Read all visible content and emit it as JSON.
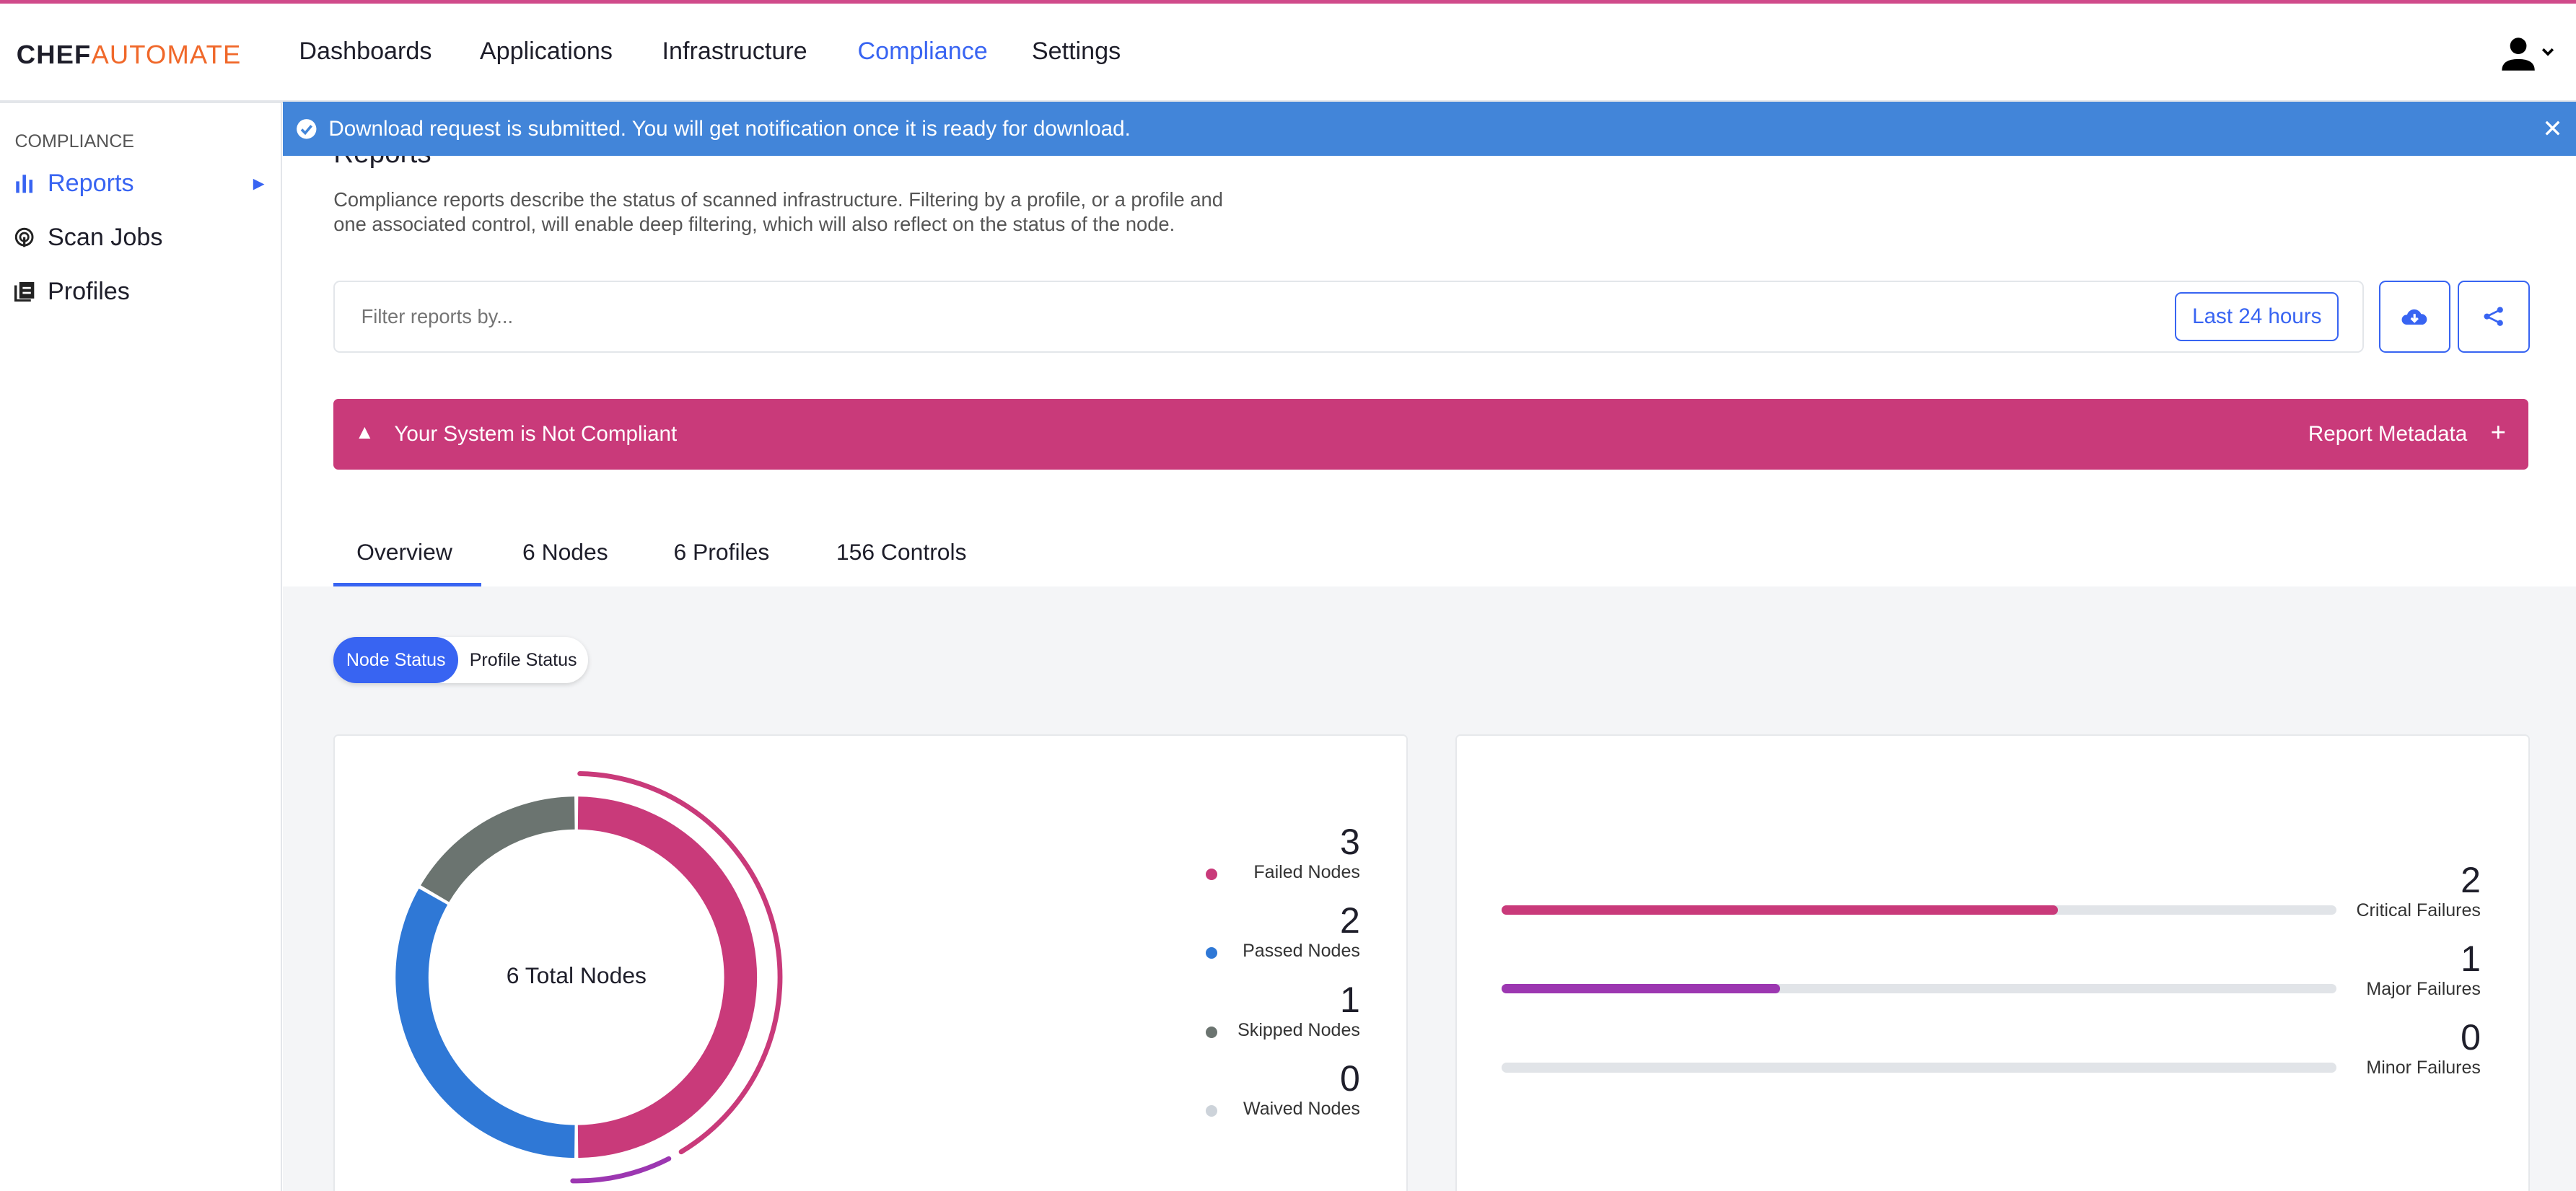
{
  "header": {
    "logo_bold": "CHEF",
    "logo_light": "AUTOMATE",
    "nav": [
      {
        "label": "Dashboards"
      },
      {
        "label": "Applications"
      },
      {
        "label": "Infrastructure"
      },
      {
        "label": "Compliance",
        "active": true
      },
      {
        "label": "Settings"
      }
    ]
  },
  "sidebar": {
    "section": "COMPLIANCE",
    "items": [
      {
        "label": "Reports",
        "icon": "bar-chart-icon",
        "active": true
      },
      {
        "label": "Scan Jobs",
        "icon": "radar-icon"
      },
      {
        "label": "Profiles",
        "icon": "book-icon"
      }
    ]
  },
  "banner": {
    "text": "Download request is submitted. You will get notification once it is ready for download.",
    "icon": "check-circle-icon"
  },
  "page": {
    "title": "Reports",
    "description": "Compliance reports describe the status of scanned infrastructure. Filtering by a profile, or a profile and one associated control, will enable deep filtering, which will also reflect on the status of the node."
  },
  "filter": {
    "placeholder": "Filter reports by...",
    "value": "",
    "date_range": "Last 24 hours"
  },
  "alert": {
    "text": "Your System is Not Compliant",
    "metadata": "Report Metadata",
    "plus": "+"
  },
  "tabs": [
    {
      "label": "Overview",
      "active": true
    },
    {
      "label": "6 Nodes"
    },
    {
      "label": "6 Profiles"
    },
    {
      "label": "156 Controls"
    }
  ],
  "toggle": {
    "options": [
      "Node Status",
      "Profile Status"
    ],
    "selected": "Node Status"
  },
  "colors": {
    "failed": "#c93a7a",
    "passed": "#2f78d6",
    "skipped": "#6b7470",
    "waived": "#cdd3da",
    "major": "#9c37b1",
    "accent": "#3864f2"
  },
  "chart_data": [
    {
      "type": "pie",
      "center_label": "6 Total Nodes",
      "series": [
        {
          "name": "Failed Nodes",
          "value": 3
        },
        {
          "name": "Passed Nodes",
          "value": 2
        },
        {
          "name": "Skipped Nodes",
          "value": 1
        },
        {
          "name": "Waived Nodes",
          "value": 0
        }
      ],
      "outer_ring": [
        {
          "name": "Critical Failures",
          "value": 2
        },
        {
          "name": "Major Failures",
          "value": 1
        }
      ]
    },
    {
      "type": "bar",
      "series": [
        {
          "name": "Critical Failures",
          "value": 2
        },
        {
          "name": "Major Failures",
          "value": 1
        },
        {
          "name": "Minor Failures",
          "value": 0
        }
      ],
      "max": 3
    }
  ]
}
